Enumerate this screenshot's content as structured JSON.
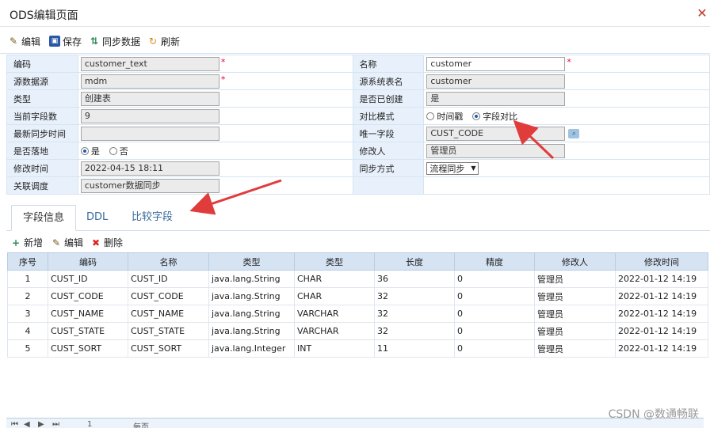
{
  "window": {
    "title": "ODS编辑页面",
    "close_icon": "close-icon"
  },
  "toolbar": {
    "edit": "编辑",
    "save": "保存",
    "sync": "同步数据",
    "refresh": "刷新"
  },
  "form": {
    "left": [
      {
        "label": "编码",
        "value": "customer_text",
        "readonly": true,
        "required": true
      },
      {
        "label": "源数据源",
        "value": "mdm",
        "readonly": true,
        "required": true
      },
      {
        "label": "类型",
        "value": "创建表",
        "readonly": true
      },
      {
        "label": "当前字段数",
        "value": "9",
        "readonly": true
      },
      {
        "label": "最新同步时间",
        "value": "",
        "readonly": true
      },
      {
        "label": "是否落地",
        "radio": [
          {
            "text": "是",
            "checked": true
          },
          {
            "text": "否",
            "checked": false
          }
        ]
      },
      {
        "label": "修改时间",
        "value": "2022-04-15 18:11",
        "readonly": true
      },
      {
        "label": "关联调度",
        "value": "customer数据同步",
        "readonly": true
      }
    ],
    "right": [
      {
        "label": "名称",
        "value": "customer",
        "readonly": false,
        "required": true
      },
      {
        "label": "源系统表名",
        "value": "customer",
        "readonly": true
      },
      {
        "label": "是否已创建",
        "value": "是",
        "readonly": true
      },
      {
        "label": "对比模式",
        "radio": [
          {
            "text": "时间戳",
            "checked": false
          },
          {
            "text": "字段对比",
            "checked": true
          }
        ]
      },
      {
        "label": "唯一字段",
        "value": "CUST_CODE",
        "readonly": true
      },
      {
        "label": "修改人",
        "value": "管理员",
        "readonly": true
      },
      {
        "label": "同步方式",
        "select": "流程同步"
      }
    ]
  },
  "tabs": [
    {
      "label": "字段信息",
      "active": true
    },
    {
      "label": "DDL",
      "active": false
    },
    {
      "label": "比较字段",
      "active": false
    }
  ],
  "grid_toolbar": {
    "add": "新增",
    "edit": "编辑",
    "delete": "删除"
  },
  "grid": {
    "headers": [
      "序号",
      "编码",
      "名称",
      "类型",
      "类型",
      "长度",
      "精度",
      "修改人",
      "修改时间"
    ],
    "rows": [
      [
        "1",
        "CUST_ID",
        "CUST_ID",
        "java.lang.String",
        "CHAR",
        "36",
        "0",
        "管理员",
        "2022-01-12 14:19"
      ],
      [
        "2",
        "CUST_CODE",
        "CUST_CODE",
        "java.lang.String",
        "CHAR",
        "32",
        "0",
        "管理员",
        "2022-01-12 14:19"
      ],
      [
        "3",
        "CUST_NAME",
        "CUST_NAME",
        "java.lang.String",
        "VARCHAR",
        "32",
        "0",
        "管理员",
        "2022-01-12 14:19"
      ],
      [
        "4",
        "CUST_STATE",
        "CUST_STATE",
        "java.lang.String",
        "VARCHAR",
        "32",
        "0",
        "管理员",
        "2022-01-12 14:19"
      ],
      [
        "5",
        "CUST_SORT",
        "CUST_SORT",
        "java.lang.Integer",
        "INT",
        "11",
        "0",
        "管理员",
        "2022-01-12 14:19"
      ]
    ]
  },
  "pager": {
    "page": "1",
    "per_page_label": "每页"
  },
  "watermark": "CSDN @数通畅联",
  "colors": {
    "label_bg": "#e8f1fb",
    "header_bg": "#d5e3f3",
    "tab_text": "#3a6a9a",
    "annotation_arrow": "#e03c3c"
  }
}
